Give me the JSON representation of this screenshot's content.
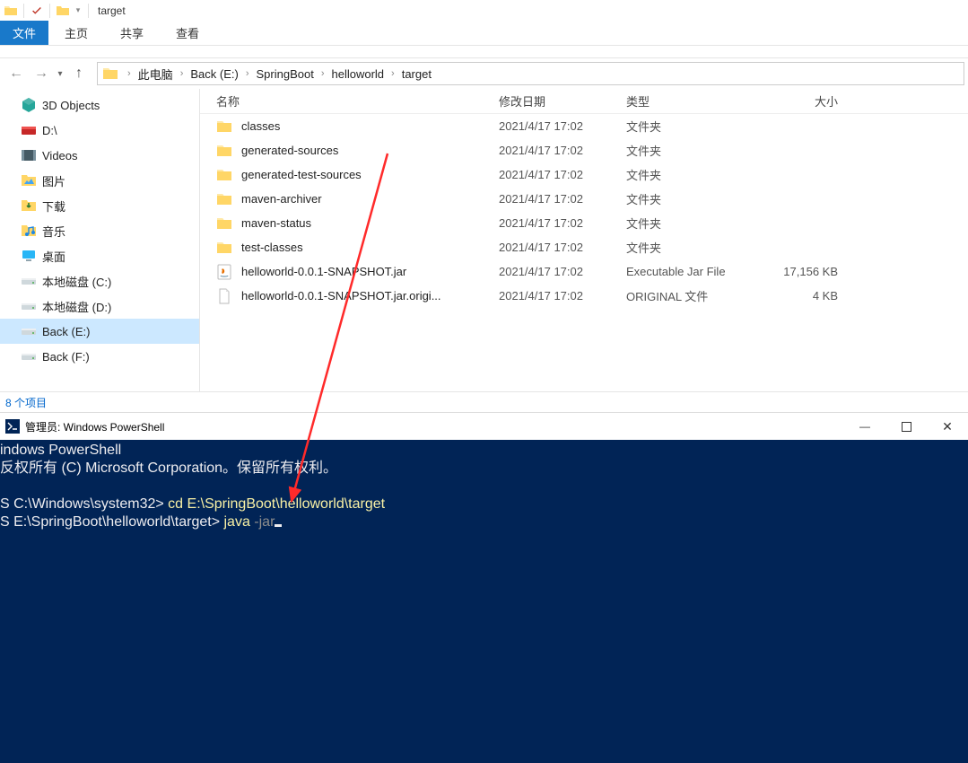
{
  "window": {
    "title": "target"
  },
  "ribbon": {
    "file": "文件",
    "tabs": [
      "主页",
      "共享",
      "查看"
    ]
  },
  "breadcrumbs": [
    "此电脑",
    "Back (E:)",
    "SpringBoot",
    "helloworld",
    "target"
  ],
  "sidebar": {
    "items": [
      {
        "label": "3D Objects",
        "icon": "cube"
      },
      {
        "label": "D:\\",
        "icon": "drive-red"
      },
      {
        "label": "Videos",
        "icon": "video"
      },
      {
        "label": "图片",
        "icon": "pic"
      },
      {
        "label": "下载",
        "icon": "download"
      },
      {
        "label": "音乐",
        "icon": "music"
      },
      {
        "label": "桌面",
        "icon": "desktop"
      },
      {
        "label": "本地磁盘 (C:)",
        "icon": "drive"
      },
      {
        "label": "本地磁盘 (D:)",
        "icon": "drive"
      },
      {
        "label": "Back (E:)",
        "icon": "drive",
        "selected": true
      },
      {
        "label": "Back (F:)",
        "icon": "drive"
      }
    ]
  },
  "columns": {
    "name": "名称",
    "date": "修改日期",
    "type": "类型",
    "size": "大小"
  },
  "files": [
    {
      "name": "classes",
      "date": "2021/4/17 17:02",
      "type": "文件夹",
      "size": "",
      "icon": "folder"
    },
    {
      "name": "generated-sources",
      "date": "2021/4/17 17:02",
      "type": "文件夹",
      "size": "",
      "icon": "folder"
    },
    {
      "name": "generated-test-sources",
      "date": "2021/4/17 17:02",
      "type": "文件夹",
      "size": "",
      "icon": "folder"
    },
    {
      "name": "maven-archiver",
      "date": "2021/4/17 17:02",
      "type": "文件夹",
      "size": "",
      "icon": "folder"
    },
    {
      "name": "maven-status",
      "date": "2021/4/17 17:02",
      "type": "文件夹",
      "size": "",
      "icon": "folder"
    },
    {
      "name": "test-classes",
      "date": "2021/4/17 17:02",
      "type": "文件夹",
      "size": "",
      "icon": "folder"
    },
    {
      "name": "helloworld-0.0.1-SNAPSHOT.jar",
      "date": "2021/4/17 17:02",
      "type": "Executable Jar File",
      "size": "17,156 KB",
      "icon": "jar"
    },
    {
      "name": "helloworld-0.0.1-SNAPSHOT.jar.origi...",
      "date": "2021/4/17 17:02",
      "type": "ORIGINAL 文件",
      "size": "4 KB",
      "icon": "file"
    }
  ],
  "status": {
    "text": "8 个项目"
  },
  "powershell": {
    "title": "管理员: Windows PowerShell",
    "lines": [
      {
        "text": "indows PowerShell"
      },
      {
        "text": "反权所有 (C) Microsoft Corporation。保留所有权利。"
      },
      {
        "text": ""
      },
      {
        "prompt": "S C:\\Windows\\system32> ",
        "cmd": "cd E:\\SpringBoot\\helloworld\\target"
      },
      {
        "prompt": "S E:\\SpringBoot\\helloworld\\target> ",
        "cmd_yellow": "java ",
        "cmd_grey": "-jar",
        "cursor": true
      }
    ]
  }
}
